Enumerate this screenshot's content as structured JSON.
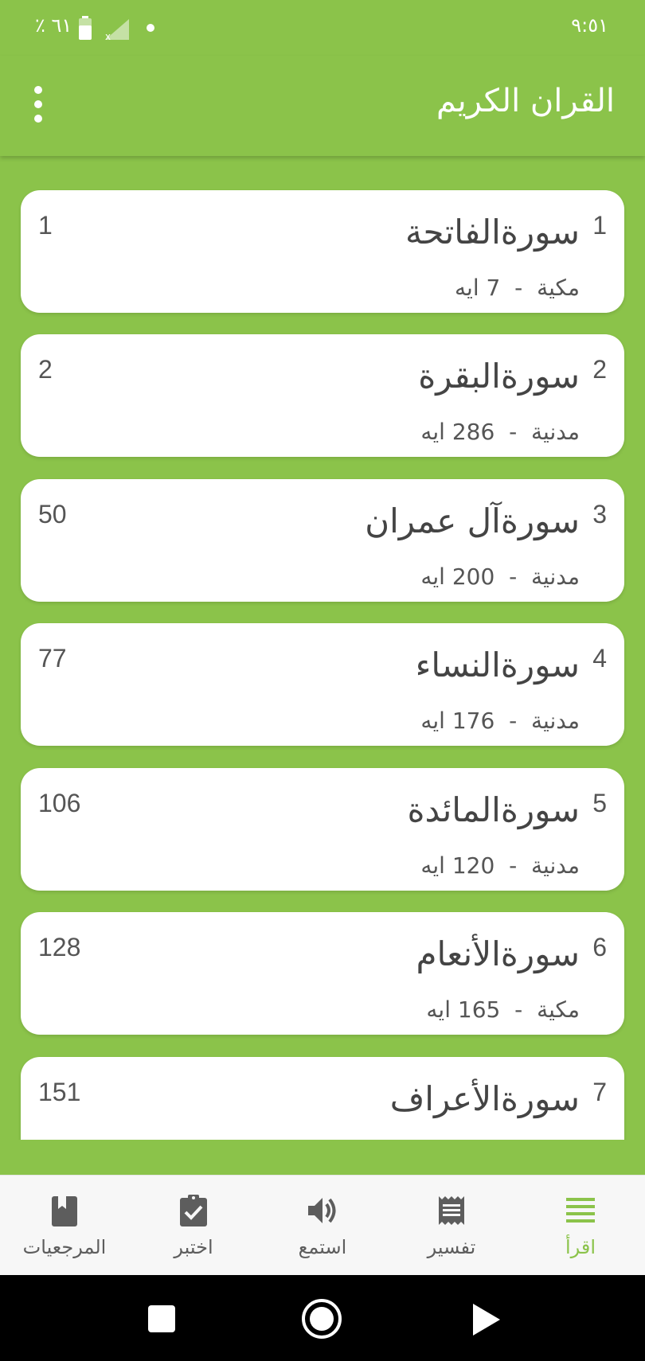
{
  "status_bar": {
    "time": "٩:٥١",
    "battery_text": "٪ ٦١"
  },
  "app_bar": {
    "title": "القران الكريم",
    "menu_icon": "more-vertical-icon"
  },
  "surahs": [
    {
      "number": "1",
      "name": "سورةالفاتحة",
      "type": "مكية",
      "ayat": "7 ايه",
      "page": "1"
    },
    {
      "number": "2",
      "name": "سورةالبقرة",
      "type": "مدنية",
      "ayat": "286 ايه",
      "page": "2"
    },
    {
      "number": "3",
      "name": "سورةآل عمران",
      "type": "مدنية",
      "ayat": "200 ايه",
      "page": "50"
    },
    {
      "number": "4",
      "name": "سورةالنساء",
      "type": "مدنية",
      "ayat": "176 ايه",
      "page": "77"
    },
    {
      "number": "5",
      "name": "سورةالمائدة",
      "type": "مدنية",
      "ayat": "120 ايه",
      "page": "106"
    },
    {
      "number": "6",
      "name": "سورةالأنعام",
      "type": "مكية",
      "ayat": "165 ايه",
      "page": "128"
    },
    {
      "number": "7",
      "name": "سورةالأعراف",
      "type": "",
      "ayat": "",
      "page": "151"
    }
  ],
  "meta_separator": "-",
  "bottom_nav": [
    {
      "label": "اقرأ",
      "icon": "list-lines-icon",
      "active": true
    },
    {
      "label": "تفسير",
      "icon": "receipt-icon",
      "active": false
    },
    {
      "label": "استمع",
      "icon": "volume-icon",
      "active": false
    },
    {
      "label": "اختبر",
      "icon": "clipboard-check-icon",
      "active": false
    },
    {
      "label": "المرجعيات",
      "icon": "bookmark-book-icon",
      "active": false
    }
  ],
  "colors": {
    "primary": "#8bc34a",
    "card": "#ffffff",
    "text": "#444444",
    "nav_inactive": "#5d5d5d"
  }
}
